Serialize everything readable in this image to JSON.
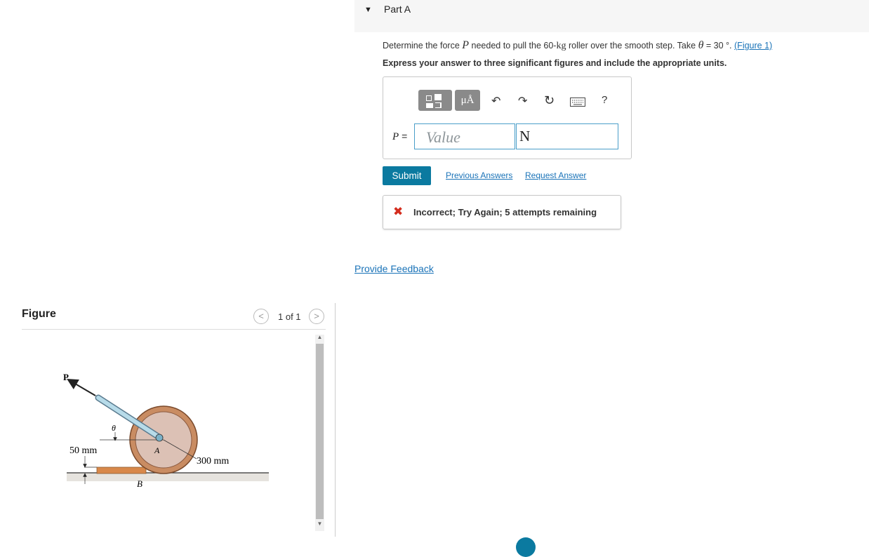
{
  "part": {
    "label": "Part A"
  },
  "question": {
    "prefix": "Determine the force",
    "force_symbol": "P",
    "middle": "needed to pull the 60-",
    "unit_kg": "kg",
    "suffix": "roller over the smooth step. Take",
    "theta_symbol": "θ",
    "theta_value": "= 30 °.",
    "figure_link": "(Figure 1)"
  },
  "instructions": "Express your answer to three significant figures and include the appropriate units.",
  "toolbar": {
    "symbols_label": "μÅ",
    "undo_icon": "↶",
    "redo_icon": "↷",
    "reset_icon": "↻",
    "help_label": "?"
  },
  "answer": {
    "var_label": "P",
    "eq_label": "=",
    "value_placeholder": "Value",
    "unit_value": "N"
  },
  "actions": {
    "submit": "Submit",
    "previous_answers": "Previous Answers",
    "request_answer": "Request Answer"
  },
  "feedback": {
    "icon": "✖",
    "text": "Incorrect; Try Again; 5 attempts remaining"
  },
  "provide_feedback": "Provide Feedback",
  "figure": {
    "title": "Figure",
    "pager": "1 of 1",
    "prev": "<",
    "next": ">",
    "labels": {
      "force": "P",
      "angle": "θ",
      "step_height": "50 mm",
      "radius": "300 mm",
      "center": "A",
      "contact": "B"
    }
  }
}
